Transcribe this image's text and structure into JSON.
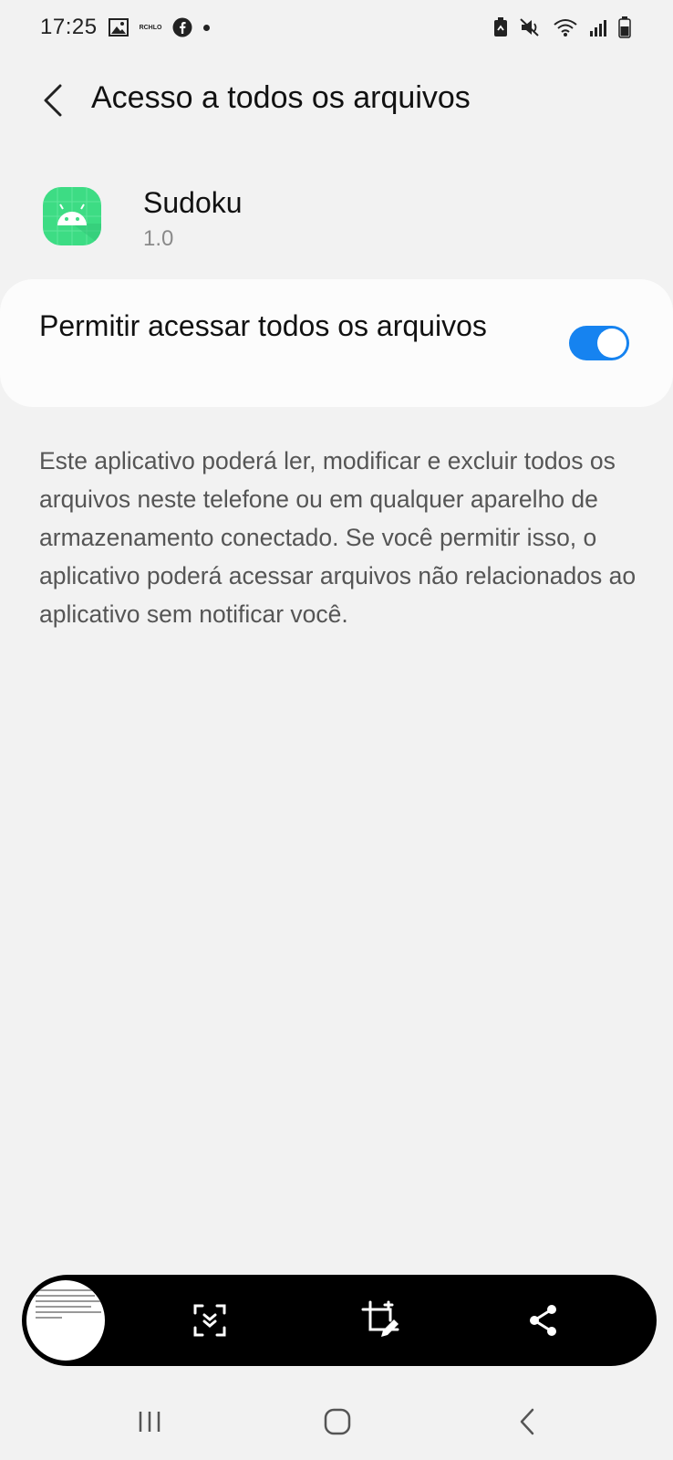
{
  "status_bar": {
    "time": "17:25",
    "left_icons": [
      "gallery-icon",
      "rchlo-icon",
      "facebook-icon",
      "dot-icon"
    ],
    "left_small_text": "RCHLO",
    "right_icons": [
      "battery-saver-icon",
      "mute-icon",
      "wifi-icon",
      "signal-icon",
      "battery-icon"
    ]
  },
  "header": {
    "title": "Acesso a todos os arquivos",
    "back_icon": "chevron-left-icon"
  },
  "app": {
    "name": "Sudoku",
    "version": "1.0",
    "icon": "android-icon",
    "icon_color": "#3ddc84"
  },
  "setting": {
    "label": "Permitir acessar todos os arquivos",
    "enabled": true,
    "switch_color": "#1683f0"
  },
  "description": "Este aplicativo poderá ler, modificar e excluir todos os arquivos neste telefone ou em qualquer aparelho de armazenamento conectado. Se você permitir isso, o aplicativo poderá acessar arquivos não relacionados ao aplicativo sem notificar você.",
  "capture_toolbar": {
    "buttons": [
      "scroll-capture-icon",
      "crop-edit-icon",
      "share-icon"
    ]
  },
  "nav": {
    "buttons": [
      "recents-icon",
      "home-icon",
      "back-icon"
    ]
  }
}
